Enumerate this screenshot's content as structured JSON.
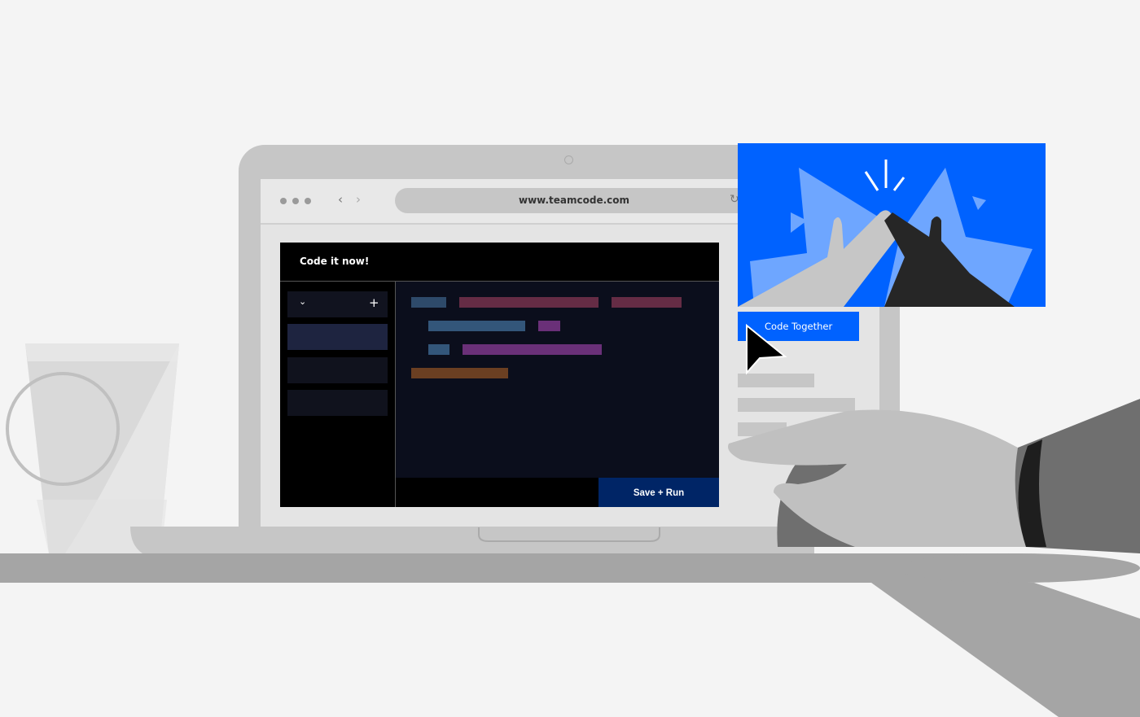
{
  "browser": {
    "url": "www.teamcode.com",
    "back_icon": "chevron-left-icon",
    "forward_icon": "chevron-right-icon",
    "reload_icon": "reload-icon"
  },
  "app": {
    "title": "Code it now!",
    "dropdown_icon": "chevron-down-icon",
    "add_icon": "plus-icon",
    "add_label": "+",
    "chevron_label": "⌄",
    "save_run_label": "Save + Run"
  },
  "promo": {
    "button_label": "Code Together",
    "image": "high-five-illustration"
  },
  "colors": {
    "background": "#f4f4f4",
    "brand_blue": "#0062ff",
    "light_blue": "#6ea6ff",
    "save_button": "#002566",
    "editor_bg": "#0b0e1c",
    "code_blue": "#2e4a6a",
    "code_red": "#652c45",
    "code_purple": "#6a3078",
    "code_orange": "#6b3f22"
  }
}
